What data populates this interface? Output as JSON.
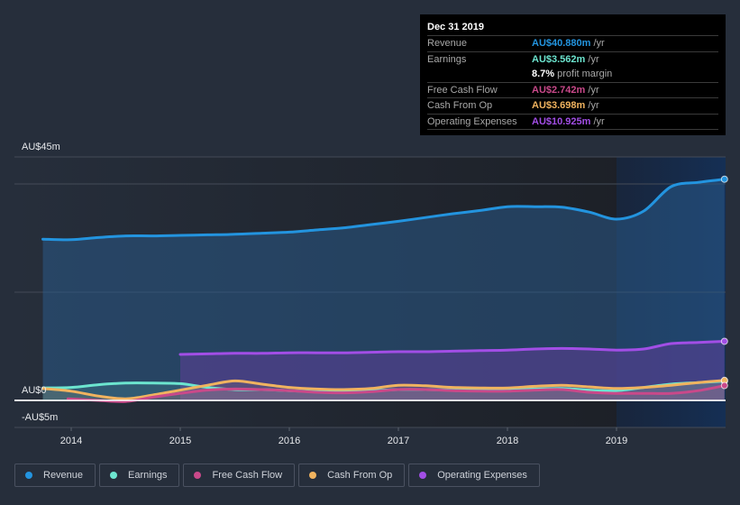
{
  "tooltip": {
    "date": "Dec 31 2019",
    "rows": [
      {
        "label": "Revenue",
        "value": "AU$40.880m",
        "unit": "/yr",
        "color": "#2394df"
      },
      {
        "label": "Earnings",
        "value": "AU$3.562m",
        "unit": "/yr",
        "color": "#6ce5cf"
      },
      {
        "label": "",
        "value": "8.7%",
        "unit": "profit margin",
        "color": "#ffffff"
      },
      {
        "label": "Free Cash Flow",
        "value": "AU$2.742m",
        "unit": "/yr",
        "color": "#c9498a"
      },
      {
        "label": "Cash From Op",
        "value": "AU$3.698m",
        "unit": "/yr",
        "color": "#f0b35f"
      },
      {
        "label": "Operating Expenses",
        "value": "AU$10.925m",
        "unit": "/yr",
        "color": "#a24ee6"
      }
    ]
  },
  "legend": [
    {
      "label": "Revenue",
      "color": "#2394df"
    },
    {
      "label": "Earnings",
      "color": "#6ce5cf"
    },
    {
      "label": "Free Cash Flow",
      "color": "#c9498a"
    },
    {
      "label": "Cash From Op",
      "color": "#f0b35f"
    },
    {
      "label": "Operating Expenses",
      "color": "#a24ee6"
    }
  ],
  "chart_data": {
    "type": "area",
    "title": "",
    "xlabel": "",
    "ylabel": "",
    "ylim": [
      -5,
      45
    ],
    "xlim": [
      2013.47,
      2019.99
    ],
    "y_tick_labels": [
      {
        "value": 45,
        "label": "AU$45m"
      },
      {
        "value": 0,
        "label": "AU$0"
      },
      {
        "value": -5,
        "label": "-AU$5m"
      }
    ],
    "gridlines": [
      45,
      40,
      20,
      0
    ],
    "x_ticks": [
      2014,
      2015,
      2016,
      2017,
      2018,
      2019
    ],
    "x_tick_labels": [
      "2014",
      "2015",
      "2016",
      "2017",
      "2018",
      "2019"
    ],
    "highlight_from": 2019.0,
    "legend_position": "bottom-left",
    "series": [
      {
        "name": "Revenue",
        "color": "#2394df",
        "x": [
          2013.74,
          2014.0,
          2014.25,
          2014.5,
          2014.75,
          2015.0,
          2015.25,
          2015.5,
          2015.75,
          2016.0,
          2016.25,
          2016.5,
          2016.75,
          2017.0,
          2017.25,
          2017.5,
          2017.75,
          2018.0,
          2018.25,
          2018.5,
          2018.75,
          2019.0,
          2019.25,
          2019.5,
          2019.75,
          2019.99
        ],
        "values": [
          29.8,
          29.7,
          30.1,
          30.4,
          30.4,
          30.5,
          30.6,
          30.7,
          30.9,
          31.1,
          31.5,
          31.9,
          32.5,
          33.1,
          33.8,
          34.5,
          35.1,
          35.8,
          35.8,
          35.7,
          34.8,
          33.5,
          35.0,
          39.5,
          40.3,
          40.88
        ]
      },
      {
        "name": "Operating Expenses",
        "color": "#a24ee6",
        "x": [
          2015.0,
          2015.25,
          2015.5,
          2015.75,
          2016.0,
          2016.25,
          2016.5,
          2016.75,
          2017.0,
          2017.25,
          2017.5,
          2017.75,
          2018.0,
          2018.25,
          2018.5,
          2018.75,
          2019.0,
          2019.25,
          2019.5,
          2019.75,
          2019.99
        ],
        "values": [
          8.5,
          8.6,
          8.7,
          8.7,
          8.8,
          8.8,
          8.8,
          8.9,
          9.0,
          9.0,
          9.1,
          9.2,
          9.3,
          9.5,
          9.6,
          9.5,
          9.3,
          9.5,
          10.5,
          10.7,
          10.925
        ]
      },
      {
        "name": "Earnings",
        "color": "#6ce5cf",
        "x": [
          2013.74,
          2014.0,
          2014.25,
          2014.5,
          2014.75,
          2015.0,
          2015.25,
          2015.5,
          2015.75,
          2016.0,
          2016.25,
          2016.5,
          2016.75,
          2017.0,
          2017.25,
          2017.5,
          2017.75,
          2018.0,
          2018.25,
          2018.5,
          2018.75,
          2019.0,
          2019.25,
          2019.5,
          2019.75,
          2019.99
        ],
        "values": [
          2.3,
          2.4,
          2.9,
          3.2,
          3.2,
          3.1,
          2.4,
          2.0,
          2.0,
          1.8,
          1.6,
          1.6,
          1.8,
          2.0,
          2.0,
          1.9,
          1.9,
          2.0,
          2.1,
          2.2,
          1.9,
          1.8,
          2.4,
          3.0,
          3.3,
          3.562
        ]
      },
      {
        "name": "Cash From Op",
        "color": "#f0b35f",
        "x": [
          2013.74,
          2014.0,
          2014.25,
          2014.5,
          2014.75,
          2015.0,
          2015.25,
          2015.5,
          2015.75,
          2016.0,
          2016.25,
          2016.5,
          2016.75,
          2017.0,
          2017.25,
          2017.5,
          2017.75,
          2018.0,
          2018.25,
          2018.5,
          2018.75,
          2019.0,
          2019.25,
          2019.5,
          2019.75,
          2019.99
        ],
        "values": [
          2.2,
          1.7,
          0.8,
          0.3,
          1.0,
          1.9,
          2.8,
          3.6,
          3.0,
          2.4,
          2.1,
          2.0,
          2.2,
          2.8,
          2.7,
          2.4,
          2.3,
          2.3,
          2.6,
          2.8,
          2.5,
          2.2,
          2.4,
          2.8,
          3.3,
          3.698
        ]
      },
      {
        "name": "Free Cash Flow",
        "color": "#c9498a",
        "x": [
          2013.97,
          2014.25,
          2014.5,
          2014.75,
          2015.0,
          2015.25,
          2015.5,
          2015.75,
          2016.0,
          2016.25,
          2016.5,
          2016.75,
          2017.0,
          2017.25,
          2017.5,
          2017.75,
          2018.0,
          2018.25,
          2018.5,
          2018.75,
          2019.0,
          2019.25,
          2019.5,
          2019.75,
          2019.99
        ],
        "values": [
          0.3,
          0.0,
          -0.2,
          0.6,
          1.3,
          1.9,
          2.1,
          2.0,
          1.8,
          1.5,
          1.4,
          1.6,
          2.0,
          2.0,
          1.8,
          1.7,
          1.7,
          1.9,
          2.0,
          1.5,
          1.3,
          1.3,
          1.3,
          1.8,
          2.742
        ]
      }
    ]
  }
}
